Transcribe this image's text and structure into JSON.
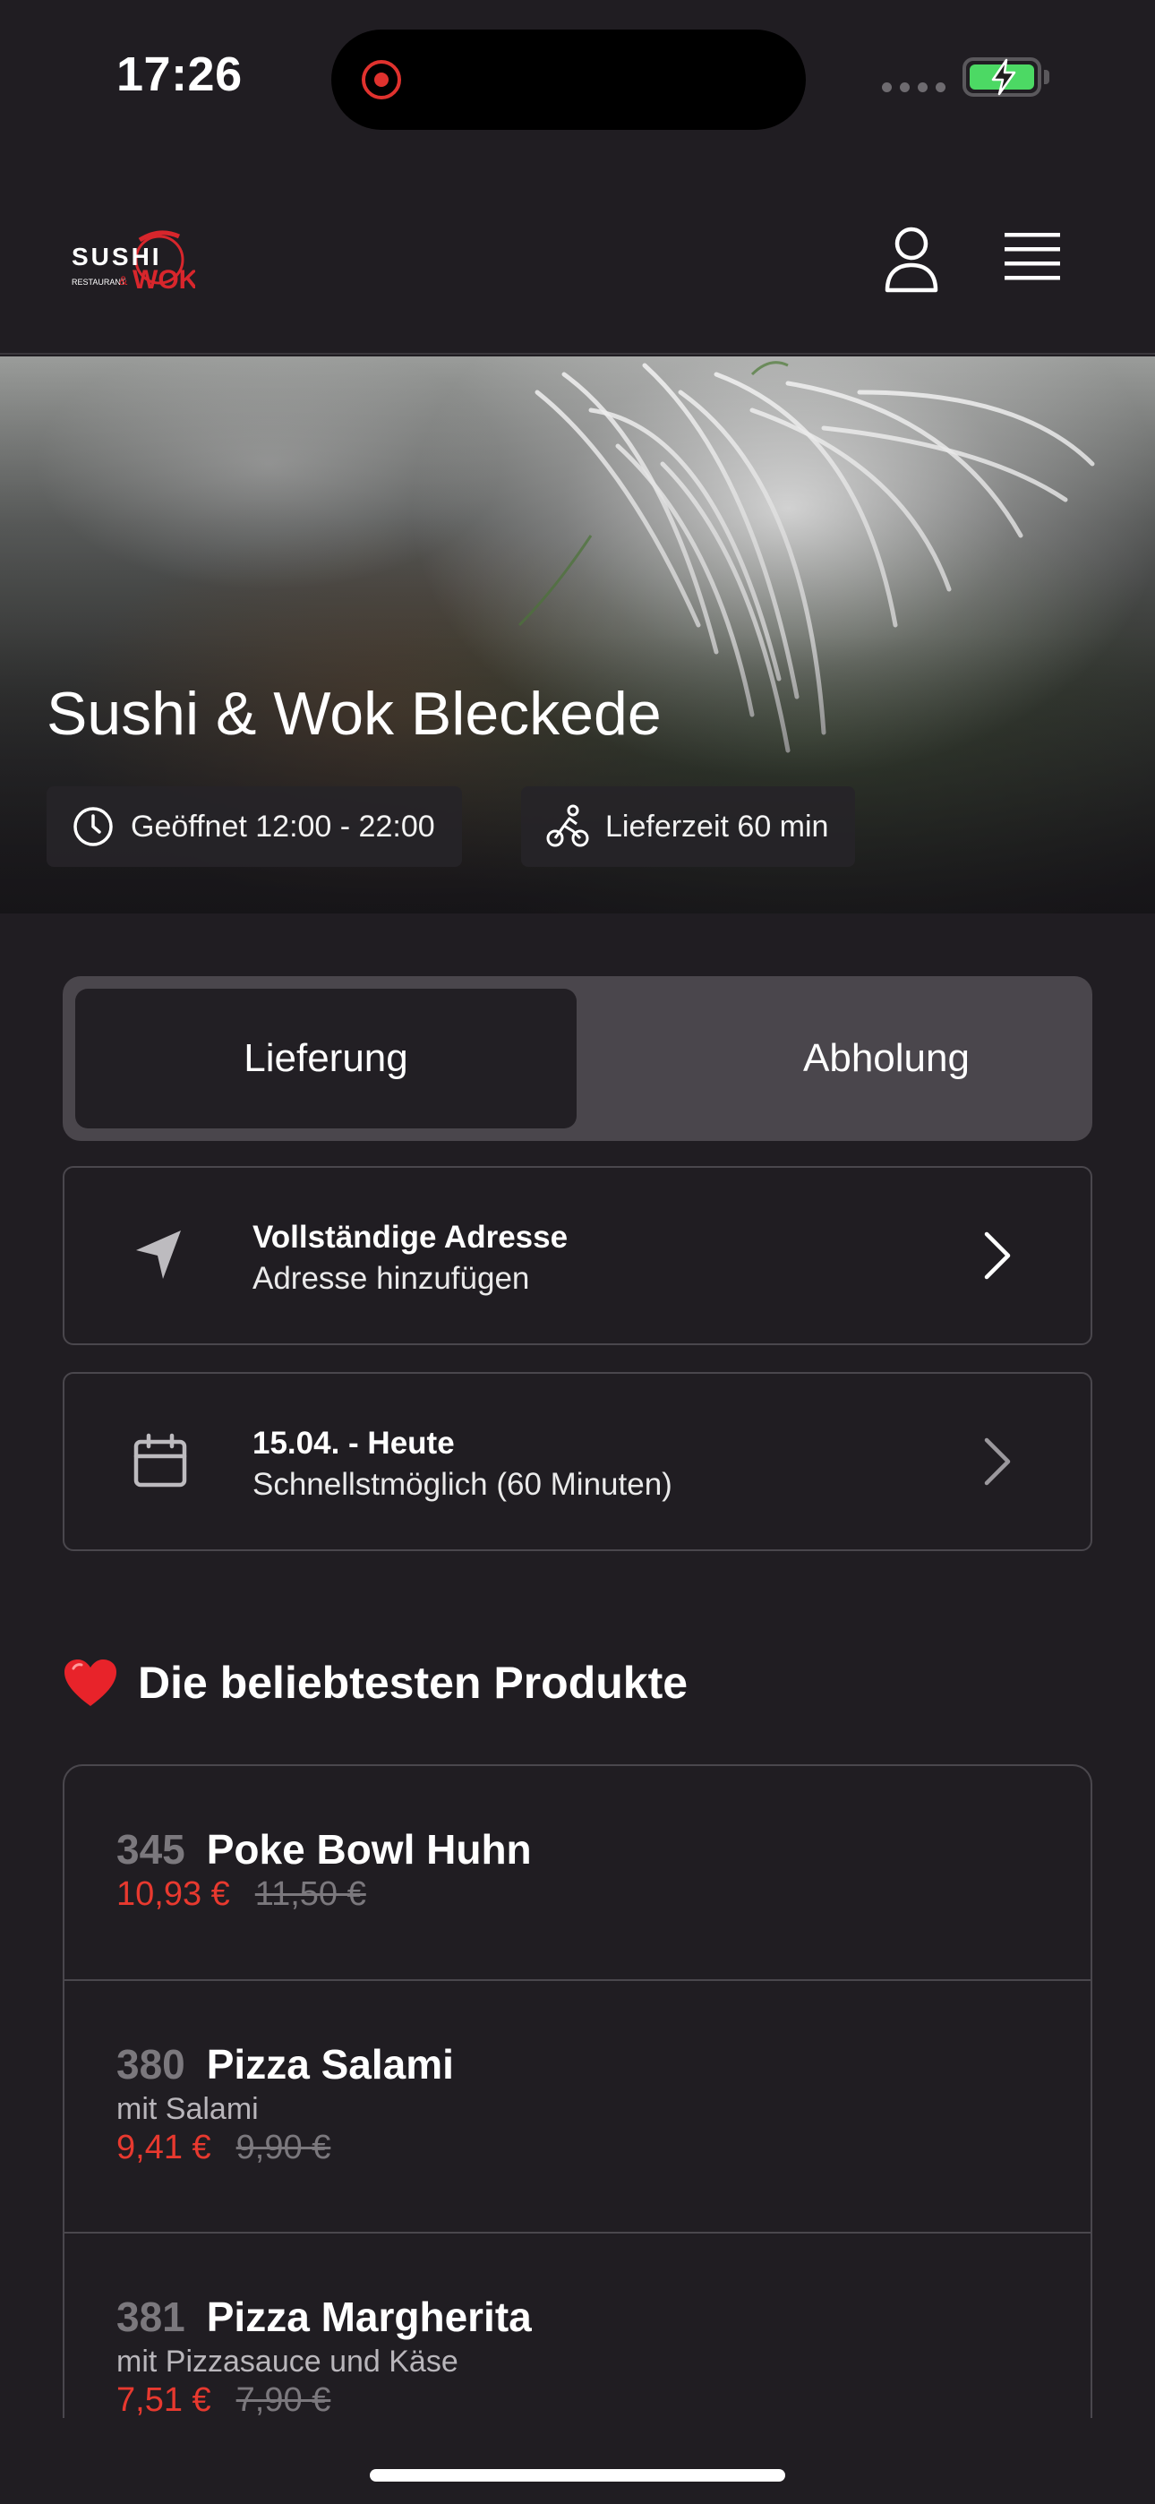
{
  "status_bar": {
    "time": "17:26",
    "battery_color": "#4cd964",
    "recording_color": "#e0322e"
  },
  "header": {
    "logo_text": "SUSHI WOK",
    "logo_subtext": "RESTAURANT",
    "user_icon": "user-icon",
    "menu_icon": "hamburger-menu-icon"
  },
  "hero": {
    "title": "Sushi & Wok Bleckede",
    "hours": "Geöffnet 12:00 - 22:00",
    "delivery_time": "Lieferzeit 60 min"
  },
  "mode_toggle": {
    "options": [
      "Lieferung",
      "Abholung"
    ],
    "selected": "Lieferung"
  },
  "address_card": {
    "title": "Vollständige Adresse",
    "subtitle": "Adresse hinzufügen",
    "icon": "location-arrow-icon"
  },
  "time_card": {
    "title": "15.04. - Heute",
    "subtitle": "Schnellstmöglich (60 Minuten)",
    "icon": "calendar-icon"
  },
  "popular": {
    "emoji": "heart-icon",
    "title": "Die beliebtesten Produkte",
    "products": [
      {
        "number": "345",
        "name": "Poke Bowl Huhn",
        "description": "",
        "price": "10,93 €",
        "old_price": "11,50 €"
      },
      {
        "number": "380",
        "name": "Pizza Salami",
        "description": "mit Salami",
        "price": "9,41 €",
        "old_price": "9,90 €"
      },
      {
        "number": "381",
        "name": "Pizza Margherita",
        "description": "mit Pizzasauce und Käse",
        "price": "7,51 €",
        "old_price": "7,90 €"
      }
    ]
  },
  "colors": {
    "background": "#201d22",
    "accent_price": "#e8392f",
    "toggle_track": "#4a464c",
    "toggle_active": "#221f24"
  }
}
